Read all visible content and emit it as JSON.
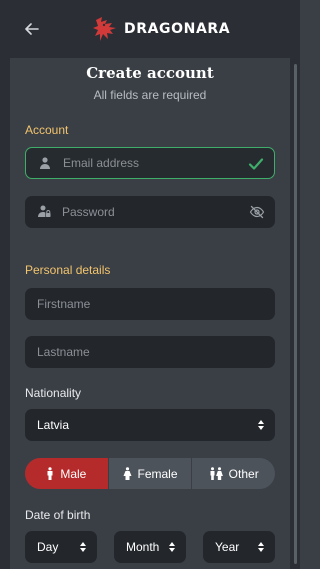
{
  "header": {
    "brand_name": "DRAGONARA"
  },
  "form": {
    "title": "Create account",
    "subtitle": "All fields are required",
    "account_section": "Account",
    "email_placeholder": "Email address",
    "password_placeholder": "Password",
    "personal_section": "Personal details",
    "firstname_placeholder": "Firstname",
    "lastname_placeholder": "Lastname",
    "nationality_label": "Nationality",
    "nationality_value": "Latvia",
    "gender_options": [
      "Male",
      "Female",
      "Other"
    ],
    "gender_selected": "Male",
    "dob_label": "Date of birth",
    "dob_day": "Day",
    "dob_month": "Month",
    "dob_year": "Year"
  },
  "colors": {
    "accent_gold": "#f3c46c",
    "valid_green": "#3fae6a",
    "active_red": "#b52a2a",
    "brand_red": "#d23a3a"
  },
  "icons": {
    "back": "arrow-left-icon",
    "brand": "dragon-logo-icon",
    "email_field": "user-icon",
    "email_status": "checkmark-icon",
    "password_field": "user-lock-icon",
    "password_toggle": "eye-slash-icon",
    "male": "male-icon",
    "female": "female-icon",
    "other": "couple-icon",
    "select_caret": "sort-caret-icon"
  }
}
